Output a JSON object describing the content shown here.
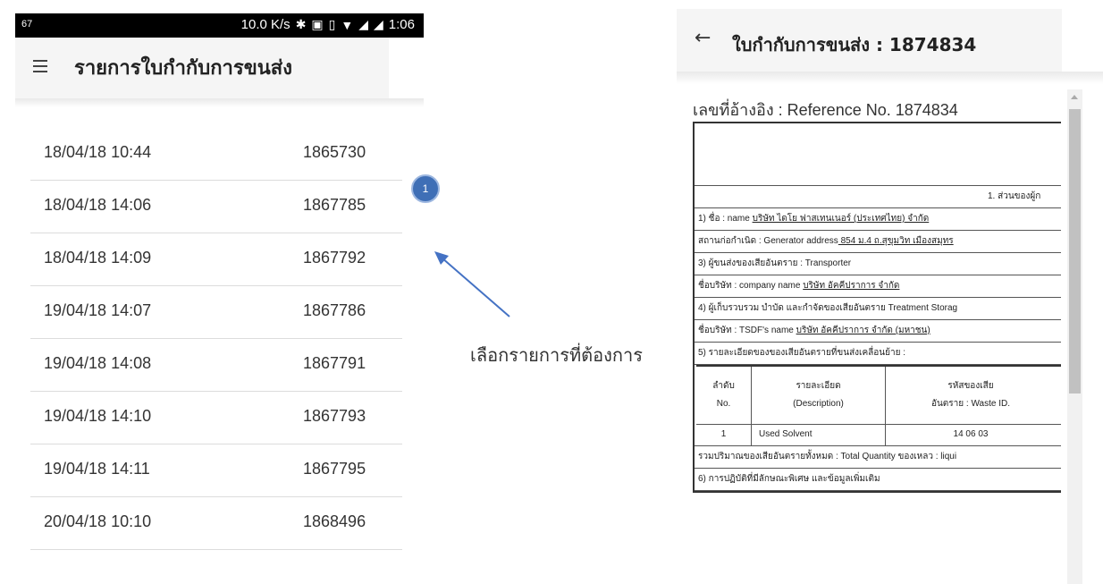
{
  "status_bar": {
    "signal_number": "67",
    "speed": "10.0 K/s",
    "time": "1:06"
  },
  "left_screen": {
    "title": "รายการใบกำกับการขนส่ง",
    "items": [
      {
        "date": "18/04/18 10:44",
        "number": "1865730"
      },
      {
        "date": "18/04/18 14:06",
        "number": "1867785"
      },
      {
        "date": "18/04/18 14:09",
        "number": "1867792"
      },
      {
        "date": "19/04/18 14:07",
        "number": "1867786"
      },
      {
        "date": "19/04/18 14:08",
        "number": "1867791"
      },
      {
        "date": "19/04/18 14:10",
        "number": "1867793"
      },
      {
        "date": "19/04/18 14:11",
        "number": "1867795"
      },
      {
        "date": "20/04/18 10:10",
        "number": "1868496"
      }
    ]
  },
  "annotation": {
    "badge": "1",
    "caption": "เลือกรายการที่ต้องการ",
    "arrow_color": "#4472c4"
  },
  "right_screen": {
    "title": "ใบกำกับการขนส่ง : 1874834",
    "reference": "เลขที่อ้างอิง : Reference No.  1874834",
    "section_header": "1. ส่วนของผู้ก",
    "rows": {
      "name_label": "1) ชื่อ : name ",
      "name_value": " บริษัท ไดโย ฟาสเทนเนอร์ (ประเทศไทย) จำกัด ",
      "address_label": "สถานก่อกำเนิด : Generator address",
      "address_value": " 854 ม.4 ถ.สุขุมวิท เมืองสมุทร",
      "transporter": "3) ผู้ขนส่งของเสียอันตราย : Transporter",
      "company_label": "ชื่อบริษัท : company name ",
      "company_value": " บริษัท อัคคีปราการ จำกัด ",
      "tsdf": "4) ผู้เก็บรวบรวม บำบัด และกำจัดของเสียอันตราย Treatment Storag",
      "tsdf_name_label": "ชื่อบริษัท : TSDF's name ",
      "tsdf_name_value": " บริษัท อัคคีปราการ จำกัด (มหาชน) ",
      "details": "5) รายละเอียดของของเสียอันตรายที่ขนส่งเคลื่อนย้าย :",
      "total": "รวมปริมาณของเสียอันตรายทั้งหมด : Total Quantity ของเหลว : liqui",
      "special": "6) การปฏิบัติที่มีลักษณะพิเศษ และข้อมูลเพิ่มเติม"
    },
    "waste_table": {
      "headers": {
        "no_th": "ลำดับ",
        "no_en": "No.",
        "desc_th": "รายละเอียด",
        "desc_en": "(Description)",
        "id_th": "รหัสของเสีย",
        "id_en": "อันตราย : Waste ID."
      },
      "row": {
        "no": "1",
        "description": "Used Solvent",
        "waste_id": "14 06 03"
      }
    }
  }
}
